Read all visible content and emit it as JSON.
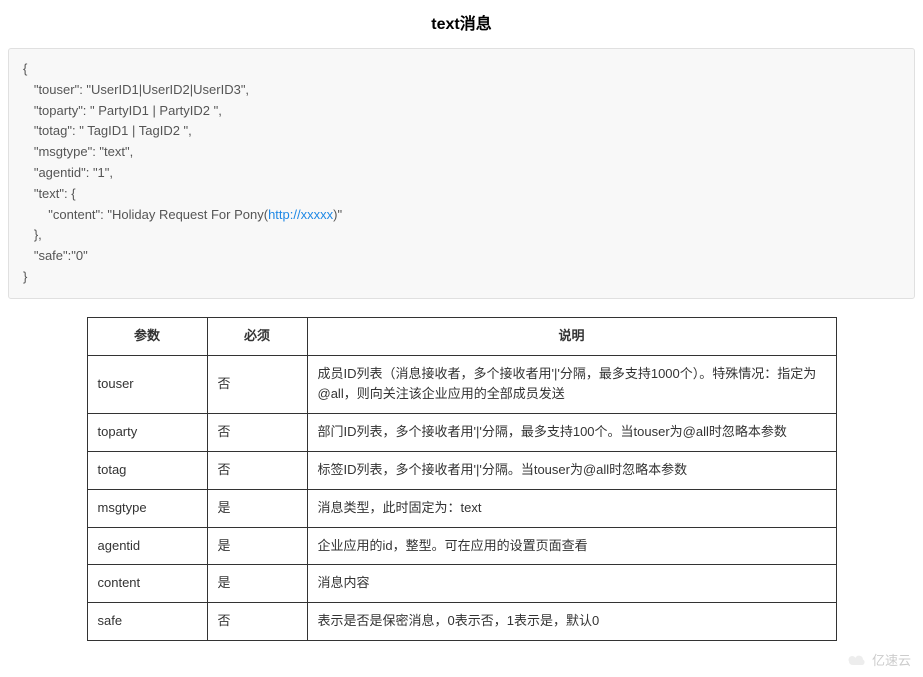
{
  "title": "text消息",
  "code": {
    "pre1": "{\n   \"touser\": \"UserID1|UserID2|UserID3\",\n   \"toparty\": \" PartyID1 | PartyID2 \",\n   \"totag\": \" TagID1 | TagID2 \",\n   \"msgtype\": \"text\",\n   \"agentid\": \"1\",\n   \"text\": {\n       \"content\": \"Holiday Request For Pony(",
    "link": "http://xxxxx",
    "post1": ")\"\n   },\n   \"safe\":\"0\"\n}"
  },
  "table": {
    "headers": {
      "param": "参数",
      "required": "必须",
      "desc": "说明"
    },
    "rows": [
      {
        "param": "touser",
        "required": "否",
        "desc": "成员ID列表（消息接收者，多个接收者用'|'分隔，最多支持1000个）。特殊情况：指定为@all，则向关注该企业应用的全部成员发送"
      },
      {
        "param": "toparty",
        "required": "否",
        "desc": "部门ID列表，多个接收者用'|'分隔，最多支持100个。当touser为@all时忽略本参数"
      },
      {
        "param": "totag",
        "required": "否",
        "desc": "标签ID列表，多个接收者用'|'分隔。当touser为@all时忽略本参数"
      },
      {
        "param": "msgtype",
        "required": "是",
        "desc": "消息类型，此时固定为：text"
      },
      {
        "param": "agentid",
        "required": "是",
        "desc": "企业应用的id，整型。可在应用的设置页面查看"
      },
      {
        "param": "content",
        "required": "是",
        "desc": "消息内容"
      },
      {
        "param": "safe",
        "required": "否",
        "desc": "表示是否是保密消息，0表示否，1表示是，默认0"
      }
    ]
  },
  "watermark": "亿速云"
}
